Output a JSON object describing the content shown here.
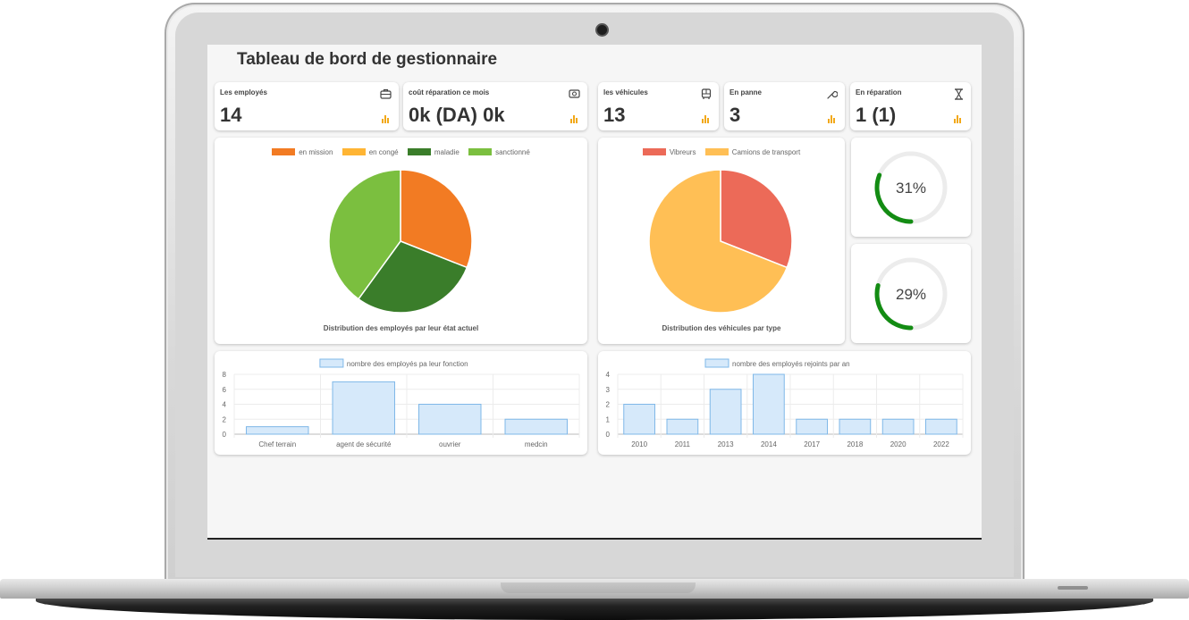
{
  "page": {
    "title": "Tableau de bord de gestionnaire"
  },
  "stats": [
    {
      "label": "Les employés",
      "value": "14",
      "icon": "briefcase-icon"
    },
    {
      "label": "coût réparation ce mois",
      "value": "0k (DA) 0k",
      "icon": "money-icon"
    },
    {
      "label": "les véhicules",
      "value": "13",
      "icon": "bus-icon"
    },
    {
      "label": "En panne",
      "value": "3",
      "icon": "wrench-icon"
    },
    {
      "label": "En réparation",
      "value": "1 (1)",
      "icon": "hourglass-icon"
    }
  ],
  "gauges": [
    {
      "percent": 31,
      "label": "31%",
      "color": "#138c13"
    },
    {
      "percent": 29,
      "label": "29%",
      "color": "#138c13"
    }
  ],
  "chart_data": [
    {
      "type": "pie",
      "title": "Distribution des employés par leur état actuel",
      "legend_position": "top",
      "categories": [
        "en mission",
        "en congé",
        "maladie",
        "sanctionné"
      ],
      "values": [
        31,
        0,
        29,
        40
      ],
      "colors": [
        "#f27b23",
        "#ffb534",
        "#3a7d2a",
        "#7bbf3f"
      ]
    },
    {
      "type": "pie",
      "title": "Distribution des véhicules par type",
      "legend_position": "top",
      "categories": [
        "Vibreurs",
        "Camions de transport"
      ],
      "values": [
        31,
        69
      ],
      "colors": [
        "#ec6a58",
        "#ffbf55"
      ]
    },
    {
      "type": "bar",
      "series": [
        {
          "name": "nombre des employés pa leur fonction",
          "values": [
            1,
            7,
            4,
            2
          ]
        }
      ],
      "categories": [
        "Chef terrain",
        "agent de sécurité",
        "ouvrier",
        "medcin"
      ],
      "ylim": [
        0,
        8
      ],
      "yticks": [
        0,
        2,
        4,
        6,
        8
      ],
      "grid": true,
      "legend_position": "top"
    },
    {
      "type": "bar",
      "series": [
        {
          "name": "nombre des employés rejoints par an",
          "values": [
            2,
            1,
            3,
            4,
            1,
            1,
            1,
            1
          ]
        }
      ],
      "categories": [
        "2010",
        "2011",
        "2013",
        "2014",
        "2017",
        "2018",
        "2020",
        "2022"
      ],
      "ylim": [
        0,
        4
      ],
      "yticks": [
        0,
        1,
        2,
        3,
        4
      ],
      "grid": true,
      "legend_position": "top"
    }
  ]
}
